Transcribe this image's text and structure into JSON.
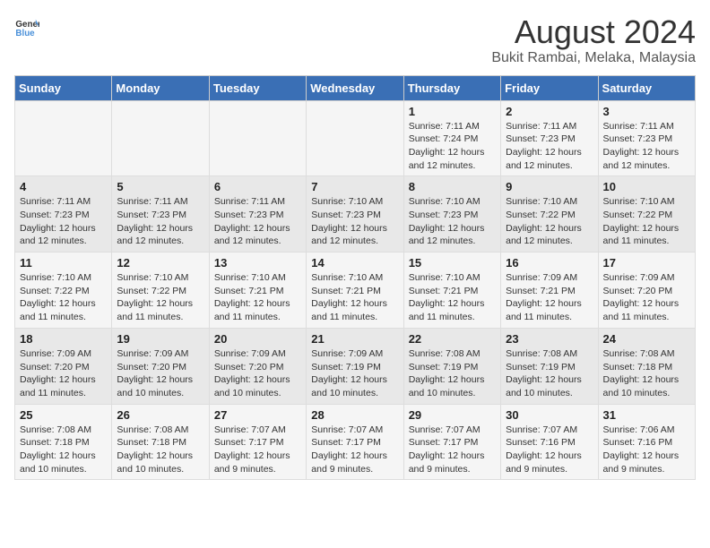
{
  "logo": {
    "general": "General",
    "blue": "Blue"
  },
  "header": {
    "title": "August 2024",
    "subtitle": "Bukit Rambai, Melaka, Malaysia"
  },
  "weekdays": [
    "Sunday",
    "Monday",
    "Tuesday",
    "Wednesday",
    "Thursday",
    "Friday",
    "Saturday"
  ],
  "weeks": [
    [
      {
        "day": null
      },
      {
        "day": null
      },
      {
        "day": null
      },
      {
        "day": null
      },
      {
        "day": 1,
        "sunrise": "7:11 AM",
        "sunset": "7:24 PM",
        "daylight": "12 hours and 12 minutes."
      },
      {
        "day": 2,
        "sunrise": "7:11 AM",
        "sunset": "7:23 PM",
        "daylight": "12 hours and 12 minutes."
      },
      {
        "day": 3,
        "sunrise": "7:11 AM",
        "sunset": "7:23 PM",
        "daylight": "12 hours and 12 minutes."
      }
    ],
    [
      {
        "day": 4,
        "sunrise": "7:11 AM",
        "sunset": "7:23 PM",
        "daylight": "12 hours and 12 minutes."
      },
      {
        "day": 5,
        "sunrise": "7:11 AM",
        "sunset": "7:23 PM",
        "daylight": "12 hours and 12 minutes."
      },
      {
        "day": 6,
        "sunrise": "7:11 AM",
        "sunset": "7:23 PM",
        "daylight": "12 hours and 12 minutes."
      },
      {
        "day": 7,
        "sunrise": "7:10 AM",
        "sunset": "7:23 PM",
        "daylight": "12 hours and 12 minutes."
      },
      {
        "day": 8,
        "sunrise": "7:10 AM",
        "sunset": "7:23 PM",
        "daylight": "12 hours and 12 minutes."
      },
      {
        "day": 9,
        "sunrise": "7:10 AM",
        "sunset": "7:22 PM",
        "daylight": "12 hours and 12 minutes."
      },
      {
        "day": 10,
        "sunrise": "7:10 AM",
        "sunset": "7:22 PM",
        "daylight": "12 hours and 11 minutes."
      }
    ],
    [
      {
        "day": 11,
        "sunrise": "7:10 AM",
        "sunset": "7:22 PM",
        "daylight": "12 hours and 11 minutes."
      },
      {
        "day": 12,
        "sunrise": "7:10 AM",
        "sunset": "7:22 PM",
        "daylight": "12 hours and 11 minutes."
      },
      {
        "day": 13,
        "sunrise": "7:10 AM",
        "sunset": "7:21 PM",
        "daylight": "12 hours and 11 minutes."
      },
      {
        "day": 14,
        "sunrise": "7:10 AM",
        "sunset": "7:21 PM",
        "daylight": "12 hours and 11 minutes."
      },
      {
        "day": 15,
        "sunrise": "7:10 AM",
        "sunset": "7:21 PM",
        "daylight": "12 hours and 11 minutes."
      },
      {
        "day": 16,
        "sunrise": "7:09 AM",
        "sunset": "7:21 PM",
        "daylight": "12 hours and 11 minutes."
      },
      {
        "day": 17,
        "sunrise": "7:09 AM",
        "sunset": "7:20 PM",
        "daylight": "12 hours and 11 minutes."
      }
    ],
    [
      {
        "day": 18,
        "sunrise": "7:09 AM",
        "sunset": "7:20 PM",
        "daylight": "12 hours and 11 minutes."
      },
      {
        "day": 19,
        "sunrise": "7:09 AM",
        "sunset": "7:20 PM",
        "daylight": "12 hours and 10 minutes."
      },
      {
        "day": 20,
        "sunrise": "7:09 AM",
        "sunset": "7:20 PM",
        "daylight": "12 hours and 10 minutes."
      },
      {
        "day": 21,
        "sunrise": "7:09 AM",
        "sunset": "7:19 PM",
        "daylight": "12 hours and 10 minutes."
      },
      {
        "day": 22,
        "sunrise": "7:08 AM",
        "sunset": "7:19 PM",
        "daylight": "12 hours and 10 minutes."
      },
      {
        "day": 23,
        "sunrise": "7:08 AM",
        "sunset": "7:19 PM",
        "daylight": "12 hours and 10 minutes."
      },
      {
        "day": 24,
        "sunrise": "7:08 AM",
        "sunset": "7:18 PM",
        "daylight": "12 hours and 10 minutes."
      }
    ],
    [
      {
        "day": 25,
        "sunrise": "7:08 AM",
        "sunset": "7:18 PM",
        "daylight": "12 hours and 10 minutes."
      },
      {
        "day": 26,
        "sunrise": "7:08 AM",
        "sunset": "7:18 PM",
        "daylight": "12 hours and 10 minutes."
      },
      {
        "day": 27,
        "sunrise": "7:07 AM",
        "sunset": "7:17 PM",
        "daylight": "12 hours and 9 minutes."
      },
      {
        "day": 28,
        "sunrise": "7:07 AM",
        "sunset": "7:17 PM",
        "daylight": "12 hours and 9 minutes."
      },
      {
        "day": 29,
        "sunrise": "7:07 AM",
        "sunset": "7:17 PM",
        "daylight": "12 hours and 9 minutes."
      },
      {
        "day": 30,
        "sunrise": "7:07 AM",
        "sunset": "7:16 PM",
        "daylight": "12 hours and 9 minutes."
      },
      {
        "day": 31,
        "sunrise": "7:06 AM",
        "sunset": "7:16 PM",
        "daylight": "12 hours and 9 minutes."
      }
    ]
  ],
  "labels": {
    "sunrise": "Sunrise:",
    "sunset": "Sunset:",
    "daylight": "Daylight:"
  }
}
